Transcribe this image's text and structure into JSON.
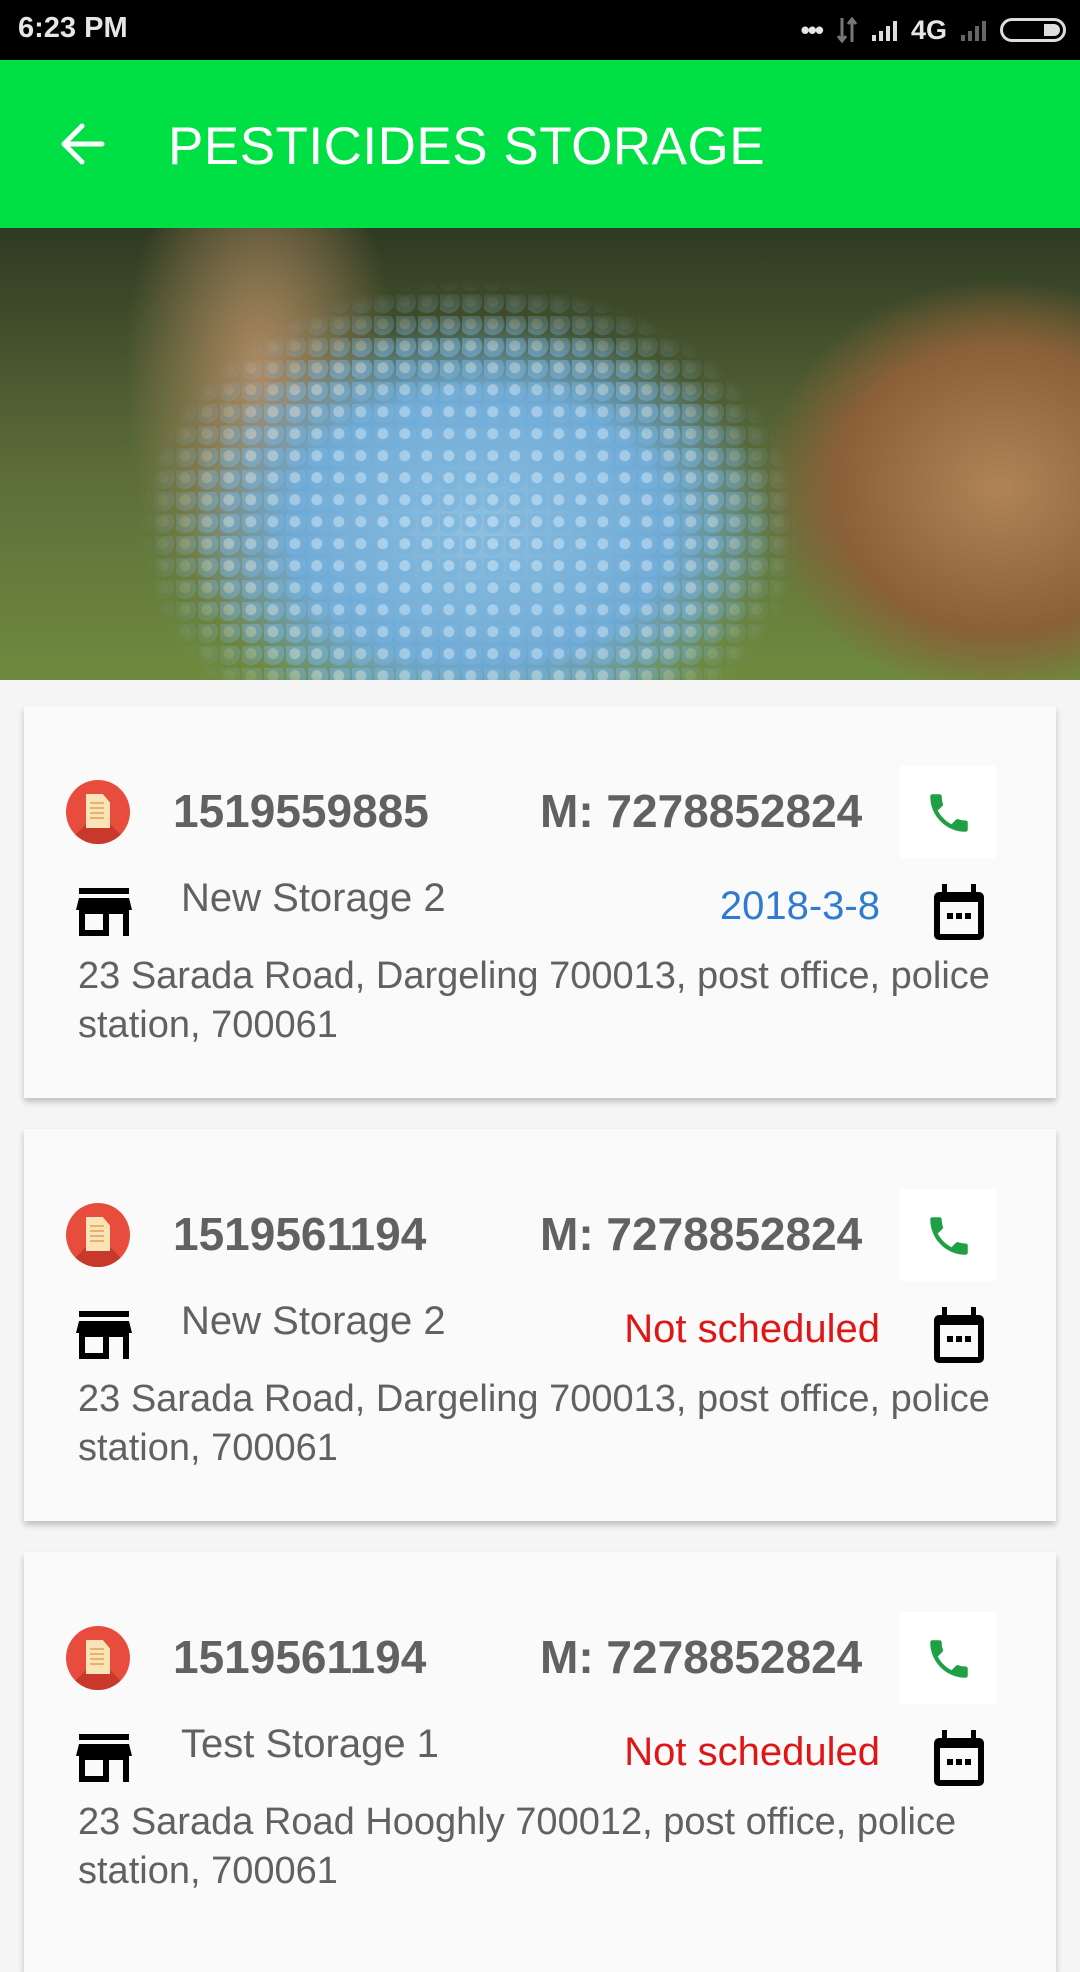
{
  "status_bar": {
    "time": "6:23 PM",
    "network": "4G",
    "icons": [
      "more-dots-icon",
      "data-arrows-icon",
      "signal-icon",
      "signal-no-sim-icon",
      "battery-icon"
    ]
  },
  "app_bar": {
    "title": "PESTICIDES STORAGE",
    "back_icon": "arrow-back-icon"
  },
  "hero": {
    "description": "blue fertilizer pellets spilling from a paper bag on grass"
  },
  "colors": {
    "app_bar": "#00e045",
    "phone_icon": "#1fa045",
    "scheduled_date": "#2f7bd1",
    "not_scheduled": "#e01616",
    "text": "#616161"
  },
  "records": [
    {
      "id": "1519559885",
      "mobile": "M: 7278852824",
      "storage": "New Storage 2",
      "schedule": "2018-3-8",
      "scheduled": true,
      "address": "23 Sarada Road, Dargeling 700013, post office, police station, 700061"
    },
    {
      "id": "1519561194",
      "mobile": "M: 7278852824",
      "storage": "New Storage 2",
      "schedule": "Not scheduled",
      "scheduled": false,
      "address": "23 Sarada Road, Dargeling 700013, post office, police station, 700061"
    },
    {
      "id": "1519561194",
      "mobile": "M: 7278852824",
      "storage": "Test Storage 1",
      "schedule": "Not scheduled",
      "scheduled": false,
      "address": "23 Sarada Road  Hooghly 700012, post office, police station, 700061"
    }
  ]
}
